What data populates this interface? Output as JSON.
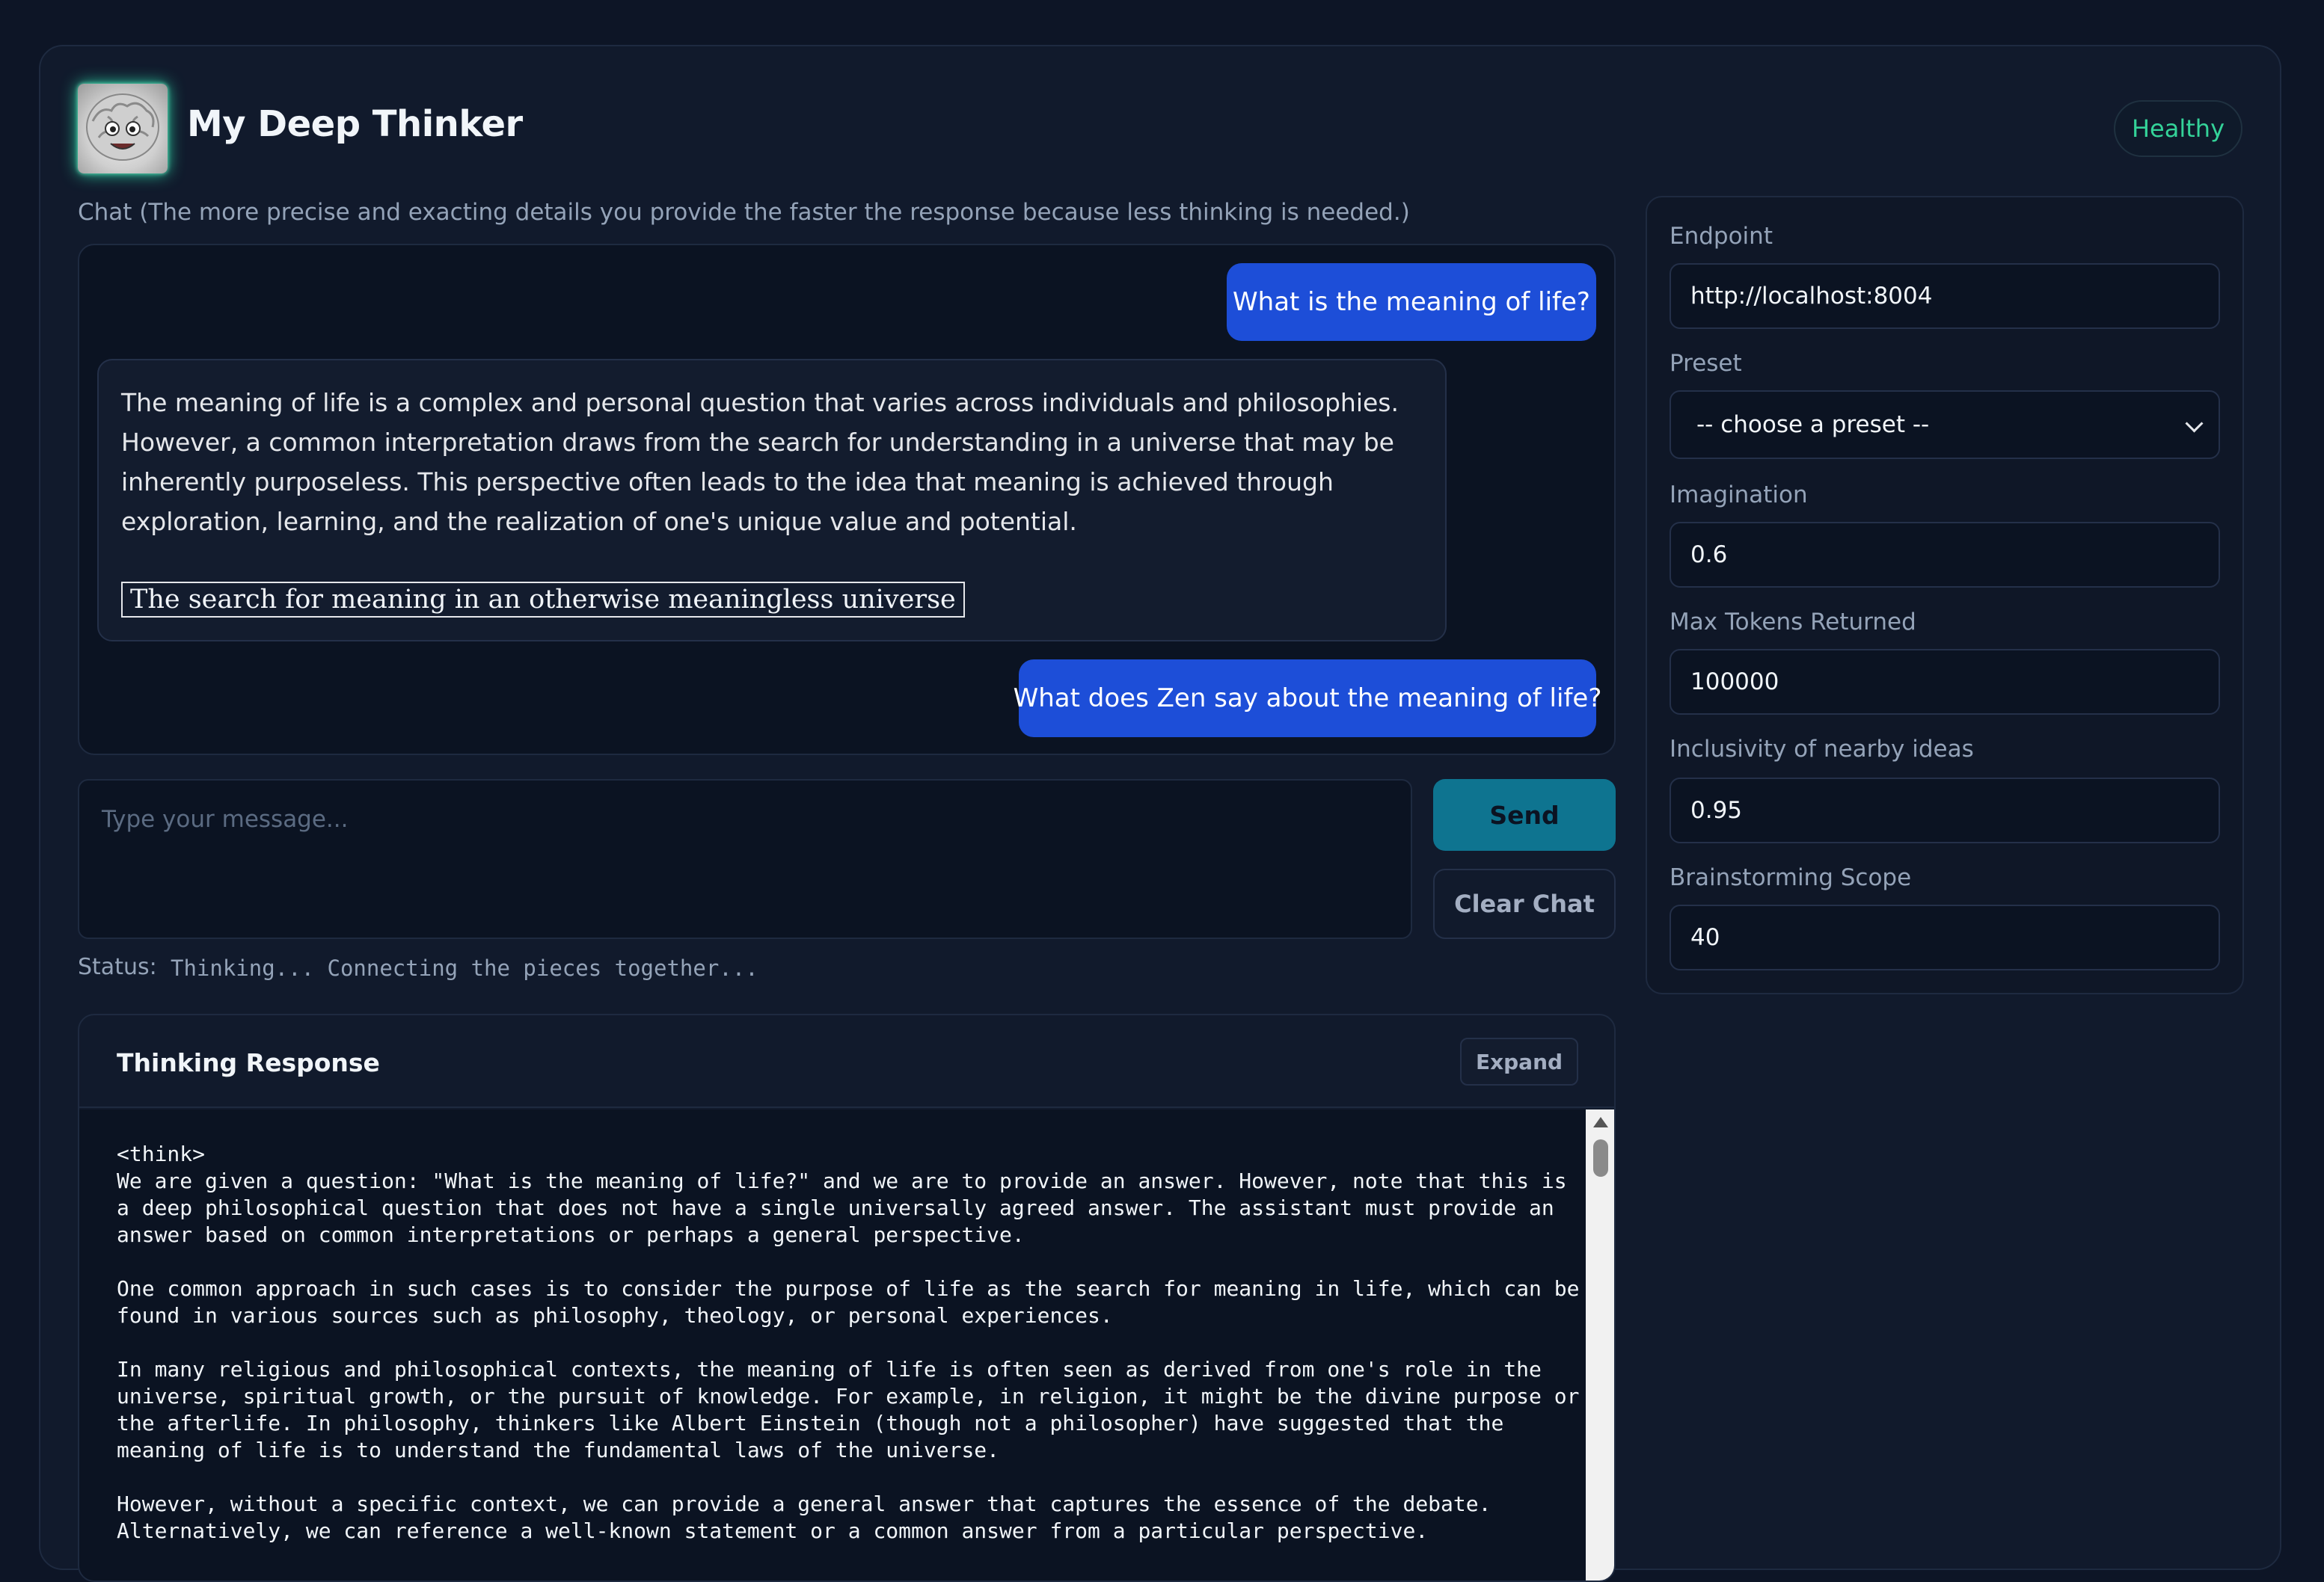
{
  "app": {
    "title": "My Deep Thinker",
    "health_status": "Healthy"
  },
  "chat": {
    "hint": "Chat (The more precise and exacting details you provide the faster the response because less thinking is needed.)",
    "messages": [
      {
        "role": "user",
        "text": "What is the meaning of life?"
      },
      {
        "role": "assistant",
        "text": "The meaning of life is a complex and personal question that varies across individuals and philosophies. However, a common interpretation draws from the search for understanding in a universe that may be inherently purposeless. This perspective often leads to the idea that meaning is achieved through exploration, learning, and the realization of one's unique value and potential.",
        "boxed": "The search for meaning in an otherwise meaningless universe"
      },
      {
        "role": "user",
        "text": "What does Zen say about the meaning of life?"
      }
    ],
    "input_placeholder": "Type your message...",
    "send_label": "Send",
    "clear_label": "Clear Chat"
  },
  "status": {
    "label": "Status:",
    "text": "Thinking... Connecting the pieces together..."
  },
  "thinking": {
    "title": "Thinking Response",
    "expand_label": "Expand",
    "content": "<think>\nWe are given a question: \"What is the meaning of life?\" and we are to provide an answer. However, note that this is\na deep philosophical question that does not have a single universally agreed answer. The assistant must provide an\nanswer based on common interpretations or perhaps a general perspective.\n\nOne common approach in such cases is to consider the purpose of life as the search for meaning in life, which can be\nfound in various sources such as philosophy, theology, or personal experiences.\n\nIn many religious and philosophical contexts, the meaning of life is often seen as derived from one's role in the\nuniverse, spiritual growth, or the pursuit of knowledge. For example, in religion, it might be the divine purpose or\nthe afterlife. In philosophy, thinkers like Albert Einstein (though not a philosopher) have suggested that the\nmeaning of life is to understand the fundamental laws of the universe.\n\nHowever, without a specific context, we can provide a general answer that captures the essence of the debate.\nAlternatively, we can reference a well-known statement or a common answer from a particular perspective."
  },
  "settings": {
    "endpoint": {
      "label": "Endpoint",
      "value": "http://localhost:8004"
    },
    "preset": {
      "label": "Preset",
      "value": "-- choose a preset --"
    },
    "imagination": {
      "label": "Imagination",
      "value": "0.6"
    },
    "max_tokens": {
      "label": "Max Tokens Returned",
      "value": "100000"
    },
    "inclusivity": {
      "label": "Inclusivity of nearby ideas",
      "value": "0.95"
    },
    "brainstorming": {
      "label": "Brainstorming Scope",
      "value": "40"
    }
  },
  "colors": {
    "accent_user_bubble": "#1d4ed8",
    "send_button": "#0e7490",
    "health": "#34d399",
    "background": "#0d1526"
  }
}
